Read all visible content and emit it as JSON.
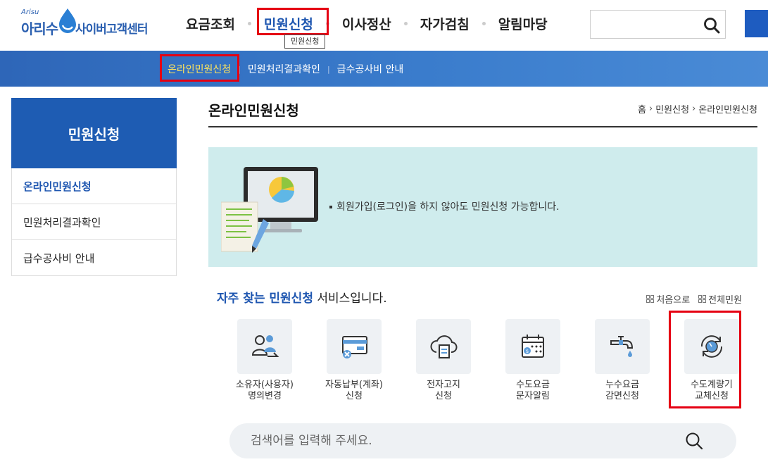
{
  "logo": {
    "small": "Arisu",
    "arisu": "아리수",
    "title": "사이버고객센터"
  },
  "gnb": {
    "items": [
      "요금조회",
      "민원신청",
      "이사정산",
      "자가검침",
      "알림마당"
    ],
    "active": "민원신청",
    "tooltip": "민원신청"
  },
  "header_search": {
    "placeholder": ""
  },
  "subnav": {
    "items": [
      "온라인민원신청",
      "민원처리결과확인",
      "급수공사비 안내"
    ]
  },
  "sidebar": {
    "title": "민원신청",
    "items": [
      "온라인민원신청",
      "민원처리결과확인",
      "급수공사비 안내"
    ]
  },
  "content": {
    "title": "온라인민원신청",
    "breadcrumb": [
      "홈",
      "민원신청",
      "온라인민원신청"
    ],
    "notice": "회원가입(로그인)을 하지 않아도 민원신청 가능합니다."
  },
  "services": {
    "heading_strong": "자주 찾는 민원신청",
    "heading_rest": " 서비스입니다.",
    "link_first": "처음으로",
    "link_all": "전체민원",
    "items": [
      {
        "line1": "소유자(사용자)",
        "line2": "명의변경",
        "icon": "owner-change-icon"
      },
      {
        "line1": "자동납부(계좌)",
        "line2": "신청",
        "icon": "auto-payment-icon"
      },
      {
        "line1": "전자고지",
        "line2": "신청",
        "icon": "e-bill-icon"
      },
      {
        "line1": "수도요금",
        "line2": "문자알림",
        "icon": "sms-alert-icon"
      },
      {
        "line1": "누수요금",
        "line2": "감면신청",
        "icon": "leak-reduction-icon"
      },
      {
        "line1": "수도계량기",
        "line2": "교체신청",
        "icon": "meter-replace-icon"
      }
    ]
  },
  "bottom_search": {
    "placeholder": "검색어를 입력해 주세요."
  },
  "colors": {
    "brand": "#1e5cb3",
    "highlight": "#e50012",
    "accent_yellow": "#ffe45c",
    "notice_bg": "#cfeced"
  }
}
